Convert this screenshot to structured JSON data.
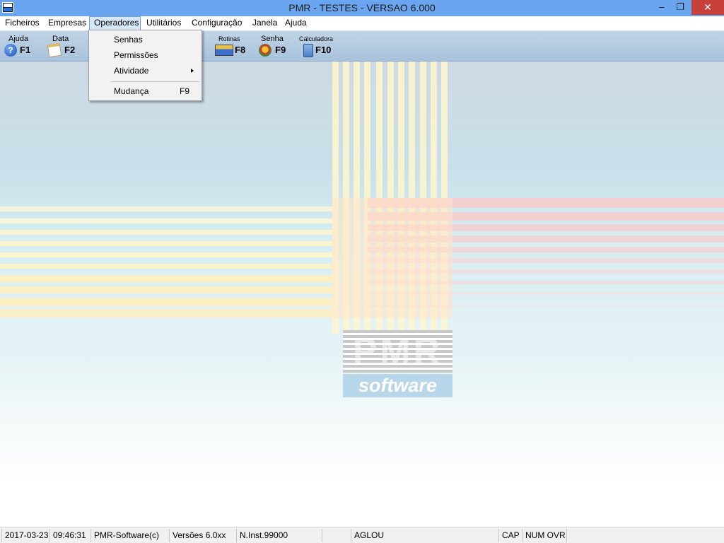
{
  "window": {
    "title": "PMR - TESTES - VERSAO 6.000",
    "controls": {
      "minimize": "–",
      "restore": "❐",
      "close": "✕"
    }
  },
  "menubar": {
    "items": [
      {
        "label": "Ficheiros"
      },
      {
        "label": "Empresas"
      },
      {
        "label": "Operadores"
      },
      {
        "label": "Utilitários"
      },
      {
        "label": "Configuração"
      },
      {
        "label": "Janela"
      },
      {
        "label": "Ajuda"
      }
    ],
    "open_menu": "Operadores"
  },
  "dropdown": {
    "items": [
      {
        "label": "Senhas",
        "shortcut": ""
      },
      {
        "label": "Permissões",
        "shortcut": ""
      },
      {
        "label": "Atividade",
        "shortcut": "",
        "submenu": true
      },
      {
        "label": "Mudança",
        "shortcut": "F9"
      }
    ]
  },
  "toolbar": {
    "buttons": [
      {
        "label": "Ajuda",
        "key": "F1",
        "icon": "help-icon"
      },
      {
        "label": "Data",
        "key": "F2",
        "icon": "calendar-icon"
      },
      {
        "label": "Rotinas",
        "key": "F8",
        "icon": "routines-icon"
      },
      {
        "label": "Senha",
        "key": "F9",
        "icon": "password-icon"
      },
      {
        "label": "Calculadora",
        "key": "F10",
        "icon": "calculator-icon"
      }
    ],
    "help_glyph": "?"
  },
  "logo": {
    "wordmark": "PMR",
    "tagline": "software"
  },
  "statusbar": {
    "date": "2017-03-23",
    "time": "09:46:31",
    "company": "PMR-Software(c)",
    "version": "Versões 6.0xx",
    "install": "N.Inst.99000",
    "empty1": "",
    "user": "AGLOU",
    "cap": "CAP",
    "numovr": "NUM OVR"
  },
  "colors": {
    "titlebar": "#6aa6f0",
    "close_button": "#c7413a",
    "toolbar": "#b3c9df",
    "menu_open": "#d5e7f8"
  }
}
